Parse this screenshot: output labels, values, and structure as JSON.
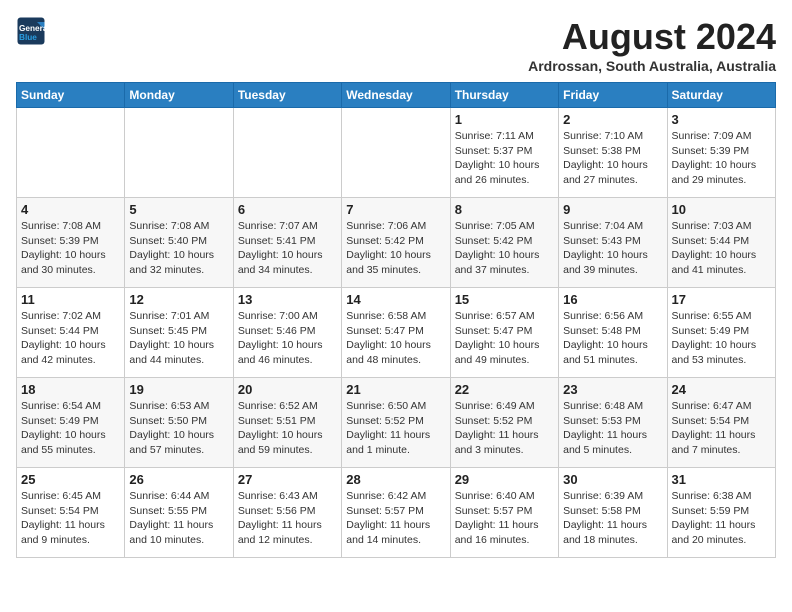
{
  "header": {
    "logo_line1": "General",
    "logo_line2": "Blue",
    "month_year": "August 2024",
    "location": "Ardrossan, South Australia, Australia"
  },
  "weekdays": [
    "Sunday",
    "Monday",
    "Tuesday",
    "Wednesday",
    "Thursday",
    "Friday",
    "Saturday"
  ],
  "weeks": [
    [
      {
        "day": "",
        "sunrise": "",
        "sunset": "",
        "daylight": ""
      },
      {
        "day": "",
        "sunrise": "",
        "sunset": "",
        "daylight": ""
      },
      {
        "day": "",
        "sunrise": "",
        "sunset": "",
        "daylight": ""
      },
      {
        "day": "",
        "sunrise": "",
        "sunset": "",
        "daylight": ""
      },
      {
        "day": "1",
        "sunrise": "7:11 AM",
        "sunset": "5:37 PM",
        "daylight": "10 hours and 26 minutes."
      },
      {
        "day": "2",
        "sunrise": "7:10 AM",
        "sunset": "5:38 PM",
        "daylight": "10 hours and 27 minutes."
      },
      {
        "day": "3",
        "sunrise": "7:09 AM",
        "sunset": "5:39 PM",
        "daylight": "10 hours and 29 minutes."
      }
    ],
    [
      {
        "day": "4",
        "sunrise": "7:08 AM",
        "sunset": "5:39 PM",
        "daylight": "10 hours and 30 minutes."
      },
      {
        "day": "5",
        "sunrise": "7:08 AM",
        "sunset": "5:40 PM",
        "daylight": "10 hours and 32 minutes."
      },
      {
        "day": "6",
        "sunrise": "7:07 AM",
        "sunset": "5:41 PM",
        "daylight": "10 hours and 34 minutes."
      },
      {
        "day": "7",
        "sunrise": "7:06 AM",
        "sunset": "5:42 PM",
        "daylight": "10 hours and 35 minutes."
      },
      {
        "day": "8",
        "sunrise": "7:05 AM",
        "sunset": "5:42 PM",
        "daylight": "10 hours and 37 minutes."
      },
      {
        "day": "9",
        "sunrise": "7:04 AM",
        "sunset": "5:43 PM",
        "daylight": "10 hours and 39 minutes."
      },
      {
        "day": "10",
        "sunrise": "7:03 AM",
        "sunset": "5:44 PM",
        "daylight": "10 hours and 41 minutes."
      }
    ],
    [
      {
        "day": "11",
        "sunrise": "7:02 AM",
        "sunset": "5:44 PM",
        "daylight": "10 hours and 42 minutes."
      },
      {
        "day": "12",
        "sunrise": "7:01 AM",
        "sunset": "5:45 PM",
        "daylight": "10 hours and 44 minutes."
      },
      {
        "day": "13",
        "sunrise": "7:00 AM",
        "sunset": "5:46 PM",
        "daylight": "10 hours and 46 minutes."
      },
      {
        "day": "14",
        "sunrise": "6:58 AM",
        "sunset": "5:47 PM",
        "daylight": "10 hours and 48 minutes."
      },
      {
        "day": "15",
        "sunrise": "6:57 AM",
        "sunset": "5:47 PM",
        "daylight": "10 hours and 49 minutes."
      },
      {
        "day": "16",
        "sunrise": "6:56 AM",
        "sunset": "5:48 PM",
        "daylight": "10 hours and 51 minutes."
      },
      {
        "day": "17",
        "sunrise": "6:55 AM",
        "sunset": "5:49 PM",
        "daylight": "10 hours and 53 minutes."
      }
    ],
    [
      {
        "day": "18",
        "sunrise": "6:54 AM",
        "sunset": "5:49 PM",
        "daylight": "10 hours and 55 minutes."
      },
      {
        "day": "19",
        "sunrise": "6:53 AM",
        "sunset": "5:50 PM",
        "daylight": "10 hours and 57 minutes."
      },
      {
        "day": "20",
        "sunrise": "6:52 AM",
        "sunset": "5:51 PM",
        "daylight": "10 hours and 59 minutes."
      },
      {
        "day": "21",
        "sunrise": "6:50 AM",
        "sunset": "5:52 PM",
        "daylight": "11 hours and 1 minute."
      },
      {
        "day": "22",
        "sunrise": "6:49 AM",
        "sunset": "5:52 PM",
        "daylight": "11 hours and 3 minutes."
      },
      {
        "day": "23",
        "sunrise": "6:48 AM",
        "sunset": "5:53 PM",
        "daylight": "11 hours and 5 minutes."
      },
      {
        "day": "24",
        "sunrise": "6:47 AM",
        "sunset": "5:54 PM",
        "daylight": "11 hours and 7 minutes."
      }
    ],
    [
      {
        "day": "25",
        "sunrise": "6:45 AM",
        "sunset": "5:54 PM",
        "daylight": "11 hours and 9 minutes."
      },
      {
        "day": "26",
        "sunrise": "6:44 AM",
        "sunset": "5:55 PM",
        "daylight": "11 hours and 10 minutes."
      },
      {
        "day": "27",
        "sunrise": "6:43 AM",
        "sunset": "5:56 PM",
        "daylight": "11 hours and 12 minutes."
      },
      {
        "day": "28",
        "sunrise": "6:42 AM",
        "sunset": "5:57 PM",
        "daylight": "11 hours and 14 minutes."
      },
      {
        "day": "29",
        "sunrise": "6:40 AM",
        "sunset": "5:57 PM",
        "daylight": "11 hours and 16 minutes."
      },
      {
        "day": "30",
        "sunrise": "6:39 AM",
        "sunset": "5:58 PM",
        "daylight": "11 hours and 18 minutes."
      },
      {
        "day": "31",
        "sunrise": "6:38 AM",
        "sunset": "5:59 PM",
        "daylight": "11 hours and 20 minutes."
      }
    ]
  ]
}
